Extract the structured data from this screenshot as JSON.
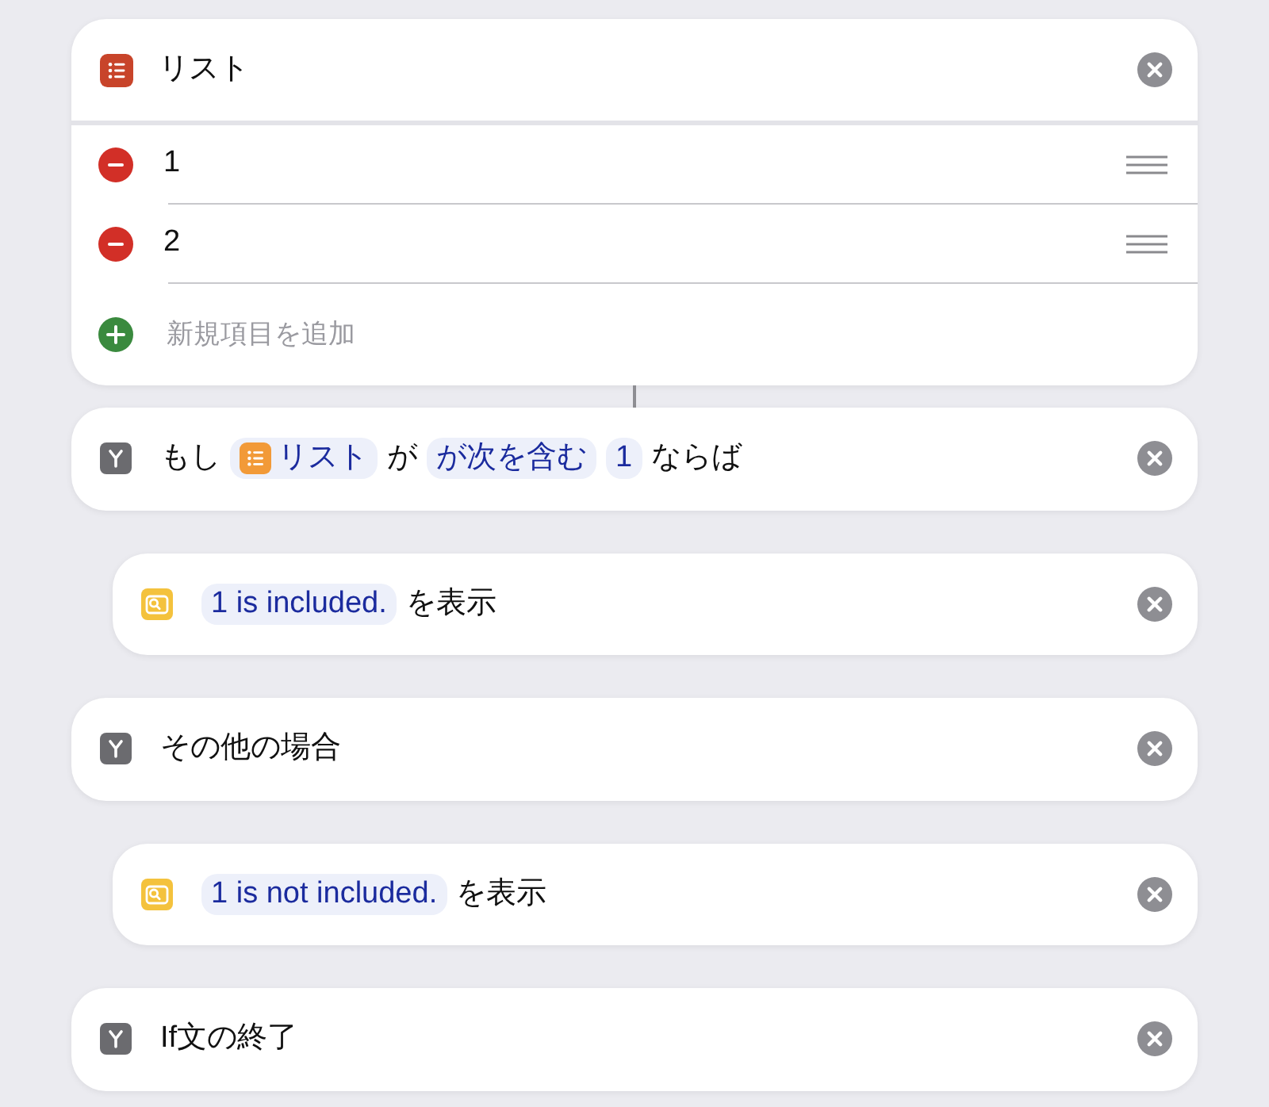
{
  "list_action": {
    "title": "リスト",
    "items": [
      {
        "text": "1"
      },
      {
        "text": "2"
      }
    ],
    "add_item": "新規項目を追加"
  },
  "actions": [
    {
      "kind": "branch",
      "parts": [
        {
          "kind": "text",
          "text": "もし"
        },
        {
          "kind": "variable",
          "text": "リスト"
        },
        {
          "kind": "text",
          "text": "が"
        },
        {
          "kind": "parameter",
          "text": "が次を含む"
        },
        {
          "kind": "parameter",
          "text": "1"
        },
        {
          "kind": "text",
          "text": "ならば"
        }
      ],
      "children": [
        {
          "kind": "show_result",
          "parts": [
            {
              "kind": "parameter",
              "text": "1 is included."
            },
            {
              "kind": "text",
              "text": "を表示"
            }
          ]
        }
      ]
    },
    {
      "kind": "branch",
      "parts": [
        {
          "kind": "text",
          "text": "その他の場合"
        }
      ],
      "children": [
        {
          "kind": "show_result",
          "parts": [
            {
              "kind": "parameter",
              "text": "1 is not included."
            },
            {
              "kind": "text",
              "text": "を表示"
            }
          ]
        }
      ]
    },
    {
      "kind": "branch",
      "parts": [
        {
          "kind": "text",
          "text": "If文の終了"
        }
      ]
    }
  ]
}
